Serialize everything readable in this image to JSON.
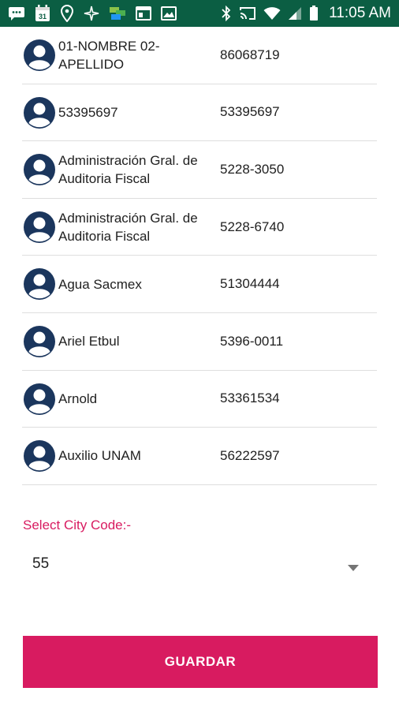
{
  "status_bar": {
    "time": "11:05 AM",
    "calendar_day": "31",
    "background_color": "#0b5e43"
  },
  "contacts": [
    {
      "name": "01-NOMBRE 02-APELLIDO",
      "phone": "86068719"
    },
    {
      "name": "53395697",
      "phone": "53395697"
    },
    {
      "name": "Administración Gral. de Auditoria Fiscal",
      "phone": "5228-3050"
    },
    {
      "name": "Administración Gral. de Auditoria Fiscal",
      "phone": "5228-6740"
    },
    {
      "name": "Agua Sacmex",
      "phone": "51304444"
    },
    {
      "name": "Ariel Etbul",
      "phone": "5396-0011"
    },
    {
      "name": "Arnold",
      "phone": "53361534"
    },
    {
      "name": "Auxilio UNAM",
      "phone": "56222597"
    }
  ],
  "city_code": {
    "label": "Select City Code:-",
    "selected_value": "55"
  },
  "save_button": {
    "label": "GUARDAR"
  },
  "colors": {
    "accent": "#d81b60",
    "avatar": "#1b365d",
    "divider": "#dedede"
  },
  "icons": {
    "contact_avatar": "person-avatar-icon",
    "dropdown": "dropdown-arrow-icon"
  }
}
